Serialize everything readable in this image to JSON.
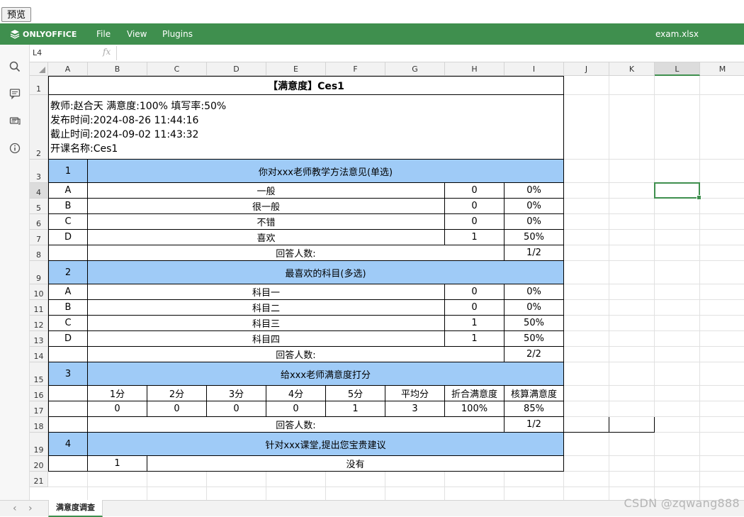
{
  "preview_button": "预览",
  "app": {
    "brand": "ONLYOFFICE",
    "menu": [
      "File",
      "View",
      "Plugins"
    ],
    "document_title": "exam.xlsx"
  },
  "left_rail": [
    "search-icon",
    "comment-icon",
    "chat-icon",
    "info-icon"
  ],
  "formula_bar": {
    "cell_ref": "L4",
    "fx": "fx",
    "value": ""
  },
  "columns": [
    "A",
    "B",
    "C",
    "D",
    "E",
    "F",
    "G",
    "H",
    "I",
    "J",
    "K",
    "L",
    "M"
  ],
  "active_column": "L",
  "rows": [
    "1",
    "2",
    "3",
    "4",
    "5",
    "6",
    "7",
    "8",
    "9",
    "10",
    "11",
    "12",
    "13",
    "14",
    "15",
    "16",
    "17",
    "18",
    "19",
    "20",
    "21"
  ],
  "active_row": "4",
  "sheet": {
    "title": "【满意度】Ces1",
    "info_lines": [
      "教师:赵合天    满意度:100%    填写率:50%",
      "发布时间:2024-08-26 11:44:16",
      "截止时间:2024-09-02 11:43:32",
      "开课名称:Ces1"
    ],
    "q1": {
      "no": "1",
      "title": "你对xxx老师教学方法意见(单选)",
      "options": [
        {
          "key": "A",
          "text": "一般",
          "count": "0",
          "pct": "0%"
        },
        {
          "key": "B",
          "text": "很一般",
          "count": "0",
          "pct": "0%"
        },
        {
          "key": "C",
          "text": "不错",
          "count": "0",
          "pct": "0%"
        },
        {
          "key": "D",
          "text": "喜欢",
          "count": "1",
          "pct": "50%"
        }
      ],
      "answer_label": "回答人数:",
      "answer_value": "1/2"
    },
    "q2": {
      "no": "2",
      "title": "最喜欢的科目(多选)",
      "options": [
        {
          "key": "A",
          "text": "科目一",
          "count": "0",
          "pct": "0%"
        },
        {
          "key": "B",
          "text": "科目二",
          "count": "0",
          "pct": "0%"
        },
        {
          "key": "C",
          "text": "科目三",
          "count": "1",
          "pct": "50%"
        },
        {
          "key": "D",
          "text": "科目四",
          "count": "1",
          "pct": "50%"
        }
      ],
      "answer_label": "回答人数:",
      "answer_value": "2/2"
    },
    "q3": {
      "no": "3",
      "title": "给xxx老师满意度打分",
      "headers": [
        "1分",
        "2分",
        "3分",
        "4分",
        "5分",
        "平均分",
        "折合满意度",
        "核算满意度"
      ],
      "values": [
        "0",
        "0",
        "0",
        "0",
        "1",
        "3",
        "100%",
        "85%"
      ],
      "answer_label": "回答人数:",
      "answer_value": "1/2"
    },
    "q4": {
      "no": "4",
      "title": "针对xxx课堂,提出您宝贵建议",
      "reply_no": "1",
      "reply_text": "没有"
    }
  },
  "sheet_tabs": [
    "满意度调查"
  ],
  "watermark": "CSDN @zqwang888"
}
